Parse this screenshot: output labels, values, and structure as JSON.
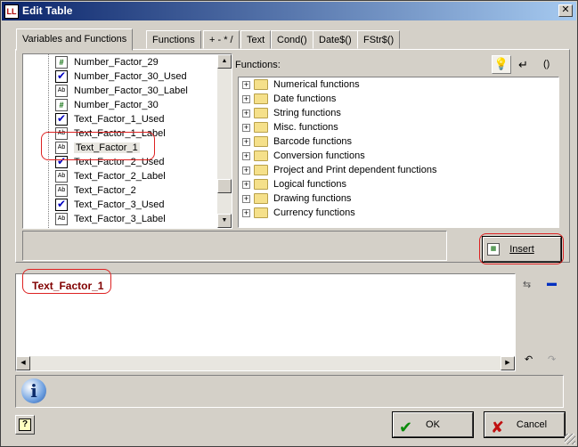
{
  "window": {
    "title": "Edit Table",
    "close_glyph": "✕"
  },
  "tabs": [
    {
      "label": "Variables and Functions",
      "active": true
    },
    {
      "label": "Functions",
      "active": false
    },
    {
      "label": "+ - * /",
      "active": false
    },
    {
      "label": "Text",
      "active": false
    },
    {
      "label": "Cond()",
      "active": false
    },
    {
      "label": "Date$()",
      "active": false
    },
    {
      "label": "FStr$()",
      "active": false
    }
  ],
  "variables": [
    {
      "label": "Number_Factor_29",
      "icon": "number-field-icon",
      "glyph": "#"
    },
    {
      "label": "Number_Factor_30_Used",
      "icon": "checkbox-field-icon",
      "glyph": "✔"
    },
    {
      "label": "Number_Factor_30_Label",
      "icon": "text-field-icon",
      "glyph": "Ab"
    },
    {
      "label": "Number_Factor_30",
      "icon": "number-field-icon",
      "glyph": "#"
    },
    {
      "label": "Text_Factor_1_Used",
      "icon": "checkbox-field-icon",
      "glyph": "✔"
    },
    {
      "label": "Text_Factor_1_Label",
      "icon": "text-field-icon",
      "glyph": "Ab"
    },
    {
      "label": "Text_Factor_1",
      "icon": "text-field-icon",
      "glyph": "Ab",
      "selected": true
    },
    {
      "label": "Text_Factor_2_Used",
      "icon": "checkbox-field-icon",
      "glyph": "✔"
    },
    {
      "label": "Text_Factor_2_Label",
      "icon": "text-field-icon",
      "glyph": "Ab"
    },
    {
      "label": "Text_Factor_2",
      "icon": "text-field-icon",
      "glyph": "Ab"
    },
    {
      "label": "Text_Factor_3_Used",
      "icon": "checkbox-field-icon",
      "glyph": "✔"
    },
    {
      "label": "Text_Factor_3_Label",
      "icon": "text-field-icon",
      "glyph": "Ab"
    }
  ],
  "functions_panel": {
    "label": "Functions:",
    "groups": [
      "Numerical functions",
      "Date functions",
      "String functions",
      "Misc. functions",
      "Barcode functions",
      "Conversion functions",
      "Project and Print dependent functions",
      "Logical functions",
      "Drawing functions",
      "Currency functions"
    ],
    "expand_glyph": "+",
    "bulb_glyph": "💡",
    "return_glyph": "↵",
    "paren_glyph": "()"
  },
  "insert_button": {
    "label": "Insert"
  },
  "editor": {
    "text": "Text_Factor_1"
  },
  "info_glyph": "i",
  "help_glyph": "?",
  "buttons": {
    "ok": {
      "label": "OK",
      "glyph": "✔",
      "color": "#0a8a0a"
    },
    "cancel": {
      "label": "Cancel",
      "glyph": "✘",
      "color": "#c01010"
    }
  },
  "scroll_glyphs": {
    "up": "▲",
    "down": "▼",
    "left": "◀",
    "right": "▶"
  },
  "editor_side_glyphs": {
    "wrap": "⇆",
    "save": "▬",
    "undo": "↶",
    "redo": "↷"
  }
}
